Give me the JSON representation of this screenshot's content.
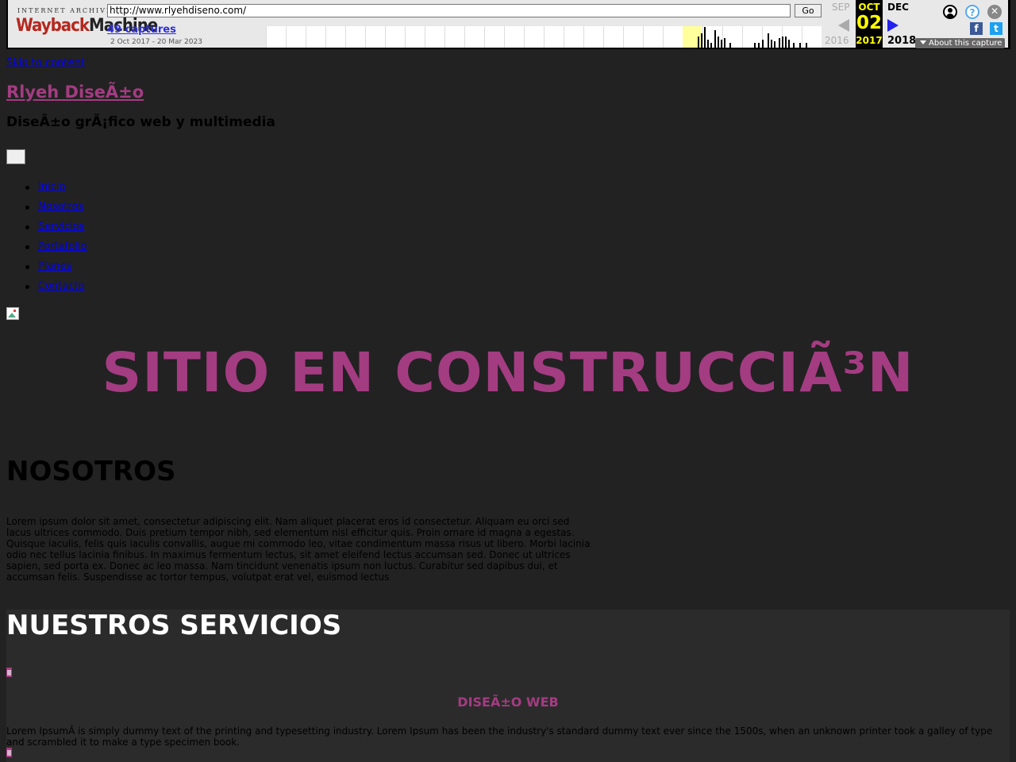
{
  "wayback": {
    "logo_top": "INTERNET ARCHIVE",
    "logo_main_1": "Wayback",
    "logo_main_2": "Machine",
    "url": "http://www.rlyehdiseno.com/",
    "go_label": "Go",
    "captures": "49 captures",
    "range": "2 Oct 2017 - 20 Mar 2023",
    "prev_month": "SEP",
    "prev_year": "2016",
    "cur_month": "OCT",
    "cur_day": "02",
    "cur_year": "2017",
    "next_month": "DEC",
    "next_year": "2018",
    "about": "About this capture",
    "icons": [
      "user-icon",
      "help-icon",
      "close-icon",
      "facebook-icon",
      "twitter-icon"
    ]
  },
  "page": {
    "skip": "Skip to content",
    "site_title": "Rlyeh DiseÃ±o",
    "site_desc": "DiseÃ±o grÃ¡fico web y multimedia",
    "menu_toggle": "",
    "nav": [
      "Inicio",
      "Nosotros",
      "Servicios",
      "Portafolio",
      "Planes",
      "Contacto"
    ],
    "hero_title": "SITIO EN CONSTRUCCIÃ³N",
    "about_heading": "NOSOTROS",
    "about_text": "Lorem ipsum dolor sit amet, consectetur adipiscing elit. Nam aliquet placerat eros id consectetur. Aliquam eu orci sed lacus ultrices commodo. Duis pretium tempor nibh, sed elementum nisl efficitur quis. Proin ornare id magna a egestas. Quisque iaculis, felis quis iaculis convallis, augue mi commodo leo, vitae condimentum massa risus ut libero. Morbi lacinia odio nec tellus lacinia finibus. In maximus fermentum lectus, sit amet eleifend lectus accumsan sed. Donec ut ultrices sapien, sed porta ex. Donec ac leo massa. Nam tincidunt venenatis ipsum non luctus. Curabitur sed dapibus dui, et accumsan felis. Suspendisse ac tortor tempus, volutpat erat vel, euismod lectus",
    "services_heading": "NUESTROS SERVICIOS",
    "service_title": "DISEÃ±O WEB",
    "service_text": "Lorem IpsumÂ is simply dummy text of the printing and typesetting industry. Lorem Ipsum has been the industry's standard dummy text ever since the 1500s, when an unknown printer took a galley of type and scrambled it to make a type specimen book."
  },
  "colors": {
    "background": "#222222",
    "accent": "#a43c82",
    "link": "#0000ee"
  }
}
